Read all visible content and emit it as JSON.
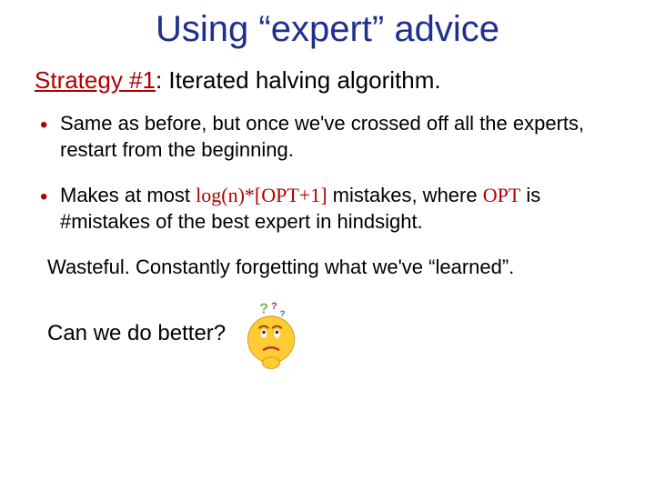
{
  "title": "Using “expert” advice",
  "subtitle": {
    "label": "Strategy #1",
    "rest": ": Iterated halving algorithm."
  },
  "bullets": [
    {
      "pre": "Same as before, but once we've crossed off all the experts, restart from the beginning.",
      "formula": "",
      "post": ""
    },
    {
      "pre": "Makes at most ",
      "formula": "log(n)*[OPT+1]",
      "mid": " mistakes, where ",
      "formula2": "OPT",
      "post": " is #mistakes of the best expert in hindsight."
    }
  ],
  "wasteful": "Wasteful. Constantly forgetting what we've “learned”.",
  "question": "Can we do better?",
  "icons": {
    "thinking_face": "thinking-face-icon"
  }
}
